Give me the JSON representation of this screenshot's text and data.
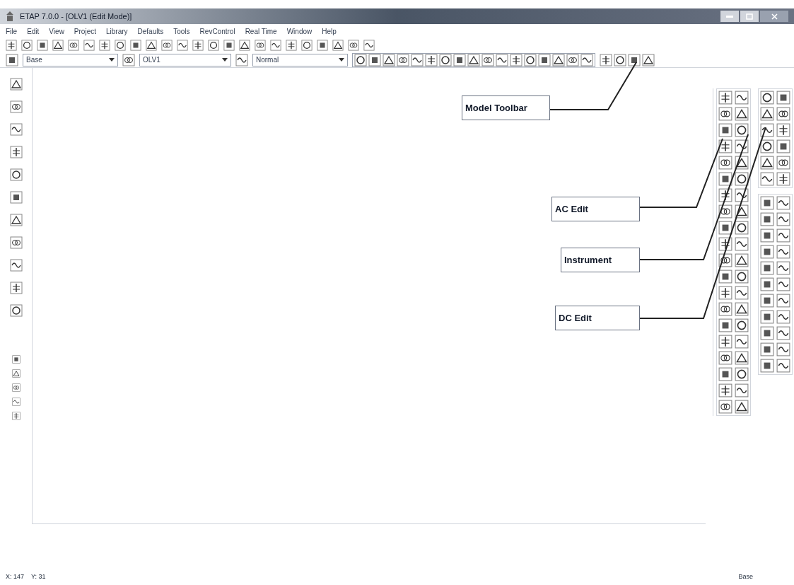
{
  "window": {
    "title": "ETAP 7.0.0 - [OLV1 (Edit Mode)]"
  },
  "menu": [
    "File",
    "Edit",
    "View",
    "Project",
    "Library",
    "Defaults",
    "Tools",
    "RevControl",
    "Real Time",
    "Window",
    "Help"
  ],
  "toolbar": {
    "presentation": "Base",
    "configuration": "OLV1",
    "mode": "Normal"
  },
  "callouts": [
    {
      "label": "Model Toolbar"
    },
    {
      "label": "AC Edit"
    },
    {
      "label": "Instrument"
    },
    {
      "label": "DC Edit"
    }
  ],
  "status_bar": {
    "x": "X: 147",
    "y": "Y: 31",
    "presentation": "Base"
  }
}
